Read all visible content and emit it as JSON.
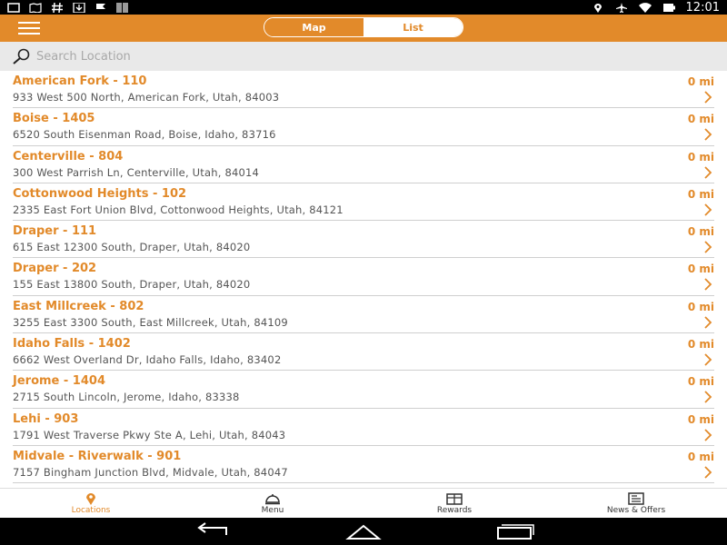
{
  "status": {
    "time": "12:01"
  },
  "header": {
    "segments": [
      {
        "label": "Map",
        "active": false
      },
      {
        "label": "List",
        "active": true
      }
    ]
  },
  "search": {
    "placeholder": "Search Location",
    "value": ""
  },
  "locations": [
    {
      "name": "American Fork - 110",
      "address": "933 West 500 North, American Fork, Utah, 84003",
      "distance": "0 mi"
    },
    {
      "name": "Boise - 1405",
      "address": "6520 South Eisenman Road, Boise, Idaho, 83716",
      "distance": "0 mi"
    },
    {
      "name": "Centerville - 804",
      "address": "300 West Parrish Ln, Centerville, Utah, 84014",
      "distance": "0 mi"
    },
    {
      "name": "Cottonwood Heights - 102",
      "address": "2335 East Fort Union Blvd, Cottonwood Heights, Utah, 84121",
      "distance": "0 mi"
    },
    {
      "name": "Draper - 111",
      "address": "615 East 12300 South, Draper, Utah, 84020",
      "distance": "0 mi"
    },
    {
      "name": "Draper - 202",
      "address": "155 East 13800 South, Draper, Utah, 84020",
      "distance": "0 mi"
    },
    {
      "name": "East Millcreek - 802",
      "address": "3255 East 3300 South, East Millcreek, Utah, 84109",
      "distance": "0 mi"
    },
    {
      "name": "Idaho Falls - 1402",
      "address": "6662 West Overland Dr, Idaho Falls, Idaho, 83402",
      "distance": "0 mi"
    },
    {
      "name": "Jerome - 1404",
      "address": "2715 South Lincoln, Jerome, Idaho, 83338",
      "distance": "0 mi"
    },
    {
      "name": "Lehi - 903",
      "address": "1791 West Traverse Pkwy Ste A, Lehi, Utah, 84043",
      "distance": "0 mi"
    },
    {
      "name": "Midvale - Riverwalk - 901",
      "address": "7157 Bingham Junction Blvd, Midvale, Utah, 84047",
      "distance": "0 mi"
    }
  ],
  "bottom_nav": [
    {
      "label": "Locations",
      "icon": "location-pin-icon",
      "active": true
    },
    {
      "label": "Menu",
      "icon": "food-cover-icon",
      "active": false
    },
    {
      "label": "Rewards",
      "icon": "gift-card-icon",
      "active": false
    },
    {
      "label": "News & Offers",
      "icon": "newspaper-icon",
      "active": false
    }
  ],
  "colors": {
    "accent": "#e28a2a",
    "search_bg": "#e9e9e9"
  }
}
